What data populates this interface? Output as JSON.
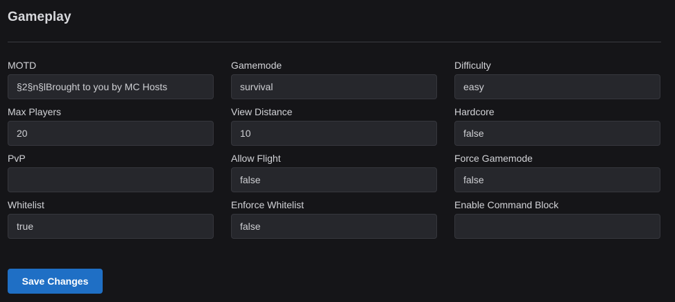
{
  "section": {
    "title": "Gameplay"
  },
  "fields": [
    {
      "label": "MOTD",
      "value": "§2§n§lBrought to you by MC Hosts"
    },
    {
      "label": "Gamemode",
      "value": "survival"
    },
    {
      "label": "Difficulty",
      "value": "easy"
    },
    {
      "label": "Max Players",
      "value": "20"
    },
    {
      "label": "View Distance",
      "value": "10"
    },
    {
      "label": "Hardcore",
      "value": "false"
    },
    {
      "label": "PvP",
      "value": ""
    },
    {
      "label": "Allow Flight",
      "value": "false"
    },
    {
      "label": "Force Gamemode",
      "value": "false"
    },
    {
      "label": "Whitelist",
      "value": "true"
    },
    {
      "label": "Enforce Whitelist",
      "value": "false"
    },
    {
      "label": "Enable Command Block",
      "value": ""
    }
  ],
  "actions": {
    "save_label": "Save Changes"
  },
  "colors": {
    "background": "#151518",
    "input_background": "#26272c",
    "accent": "#1f6fc5"
  }
}
